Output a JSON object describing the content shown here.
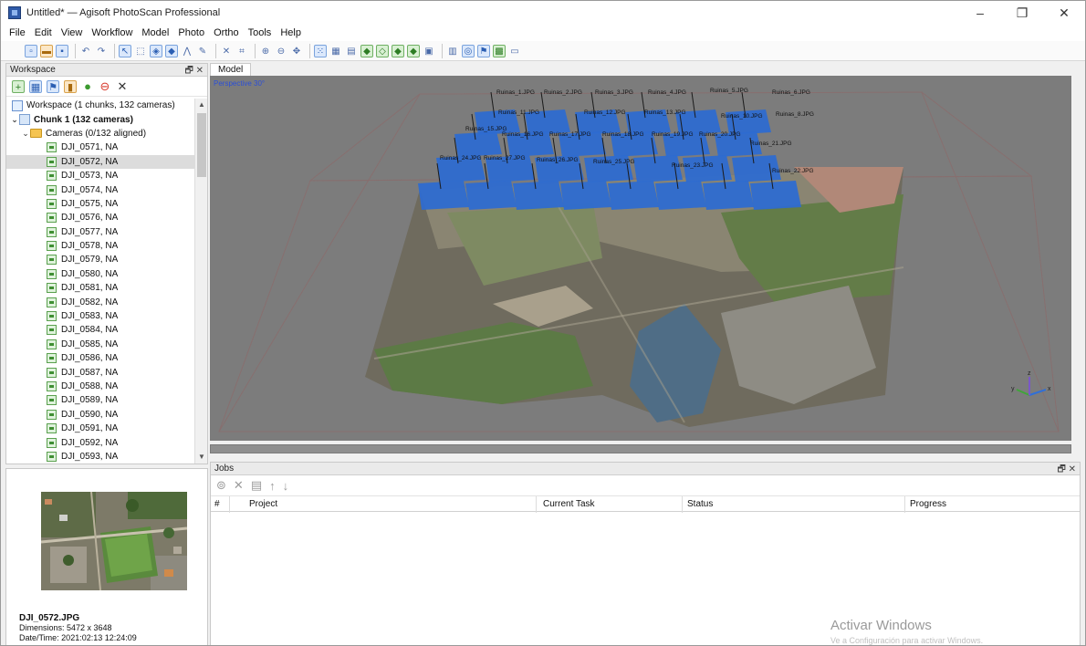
{
  "window": {
    "title": "Untitled* — Agisoft PhotoScan Professional",
    "controls": [
      "–",
      "❐",
      "✕"
    ]
  },
  "menu": [
    "File",
    "Edit",
    "View",
    "Workflow",
    "Model",
    "Photo",
    "Ortho",
    "Tools",
    "Help"
  ],
  "workspace": {
    "panel_title": "Workspace",
    "header_buttons": "🗗 ✕",
    "root_label": "Workspace (1 chunks, 132 cameras)",
    "chunk_label": "Chunk 1 (132 cameras)",
    "cameras_label": "Cameras (0/132 aligned)",
    "cameras": [
      "DJI_0571, NA",
      "DJI_0572, NA",
      "DJI_0573, NA",
      "DJI_0574, NA",
      "DJI_0575, NA",
      "DJI_0576, NA",
      "DJI_0577, NA",
      "DJI_0578, NA",
      "DJI_0579, NA",
      "DJI_0580, NA",
      "DJI_0581, NA",
      "DJI_0582, NA",
      "DJI_0583, NA",
      "DJI_0584, NA",
      "DJI_0585, NA",
      "DJI_0586, NA",
      "DJI_0587, NA",
      "DJI_0588, NA",
      "DJI_0589, NA",
      "DJI_0590, NA",
      "DJI_0591, NA",
      "DJI_0592, NA",
      "DJI_0593, NA"
    ],
    "selected_camera": "DJI_0572, NA"
  },
  "preview": {
    "filename": "DJI_0572.JPG",
    "dimensions": "Dimensions: 5472 x 3648",
    "datetime": "Date/Time: 2021:02:13 12:24:09"
  },
  "model": {
    "tab_label": "Model",
    "view_label": "Perspective 30°",
    "camera_labels": [
      "Ruinas_1.JPG",
      "Ruinas_2.JPG",
      "Ruinas_3.JPG",
      "Ruinas_4.JPG",
      "Ruinas_5.JPG",
      "Ruinas_6.JPG",
      "Ruinas_11.JPG",
      "Ruinas_12.JPG",
      "Ruinas_13.JPG",
      "Ruinas_10.JPG",
      "Ruinas_8.JPG",
      "Ruinas_15.JPG",
      "Ruinas_16.JPG",
      "Ruinas_17.JPG",
      "Ruinas_18.JPG",
      "Ruinas_19.JPG",
      "Ruinas_20.JPG",
      "Ruinas_21.JPG",
      "Ruinas_24.JPG",
      "Ruinas_27.JPG",
      "Ruinas_26.JPG",
      "Ruinas_25.JPG",
      "Ruinas_23.JPG",
      "Ruinas_22.JPG"
    ]
  },
  "jobs": {
    "panel_title": "Jobs",
    "header_buttons": "🗗 ✕",
    "tool_icons": [
      "⊚",
      "✕",
      "▤",
      "↑",
      "↓"
    ],
    "columns": [
      "#",
      "Project",
      "Current Task",
      "Status",
      "Progress"
    ]
  },
  "watermark": {
    "title": "Activar Windows",
    "subtitle": "Ve a Configuración para activar Windows."
  },
  "colors": {
    "camera_plane": "#2e6bd0",
    "viewport_bg": "#7c7c7c",
    "accent": "#2b5fb3"
  }
}
